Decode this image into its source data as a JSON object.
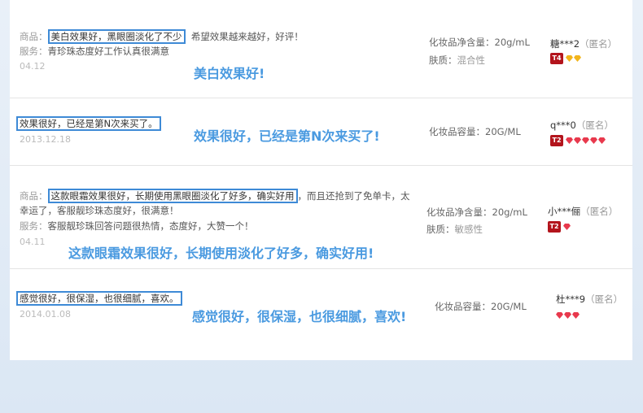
{
  "reviews": [
    {
      "product_label": "商品：",
      "product_text": "美白效果好，黑眼圈淡化了不少",
      "product_more": "希望效果越来越好，好评！",
      "service_label": "服务：",
      "service_text": "青珍珠态度好工作认真很满意",
      "date": "04.12",
      "annotation": "美白效果好!",
      "attr1": "化妆品净含量：20g/mL",
      "attr2_label": "肤质：",
      "attr2_value": "混合性",
      "user": "糖***2",
      "anon": "（匿名）",
      "level": "T4",
      "gem_color": "gold",
      "gem_count": 2
    },
    {
      "product_text": "效果很好，已经是第N次来买了。",
      "date": "2013.12.18",
      "annotation": "效果很好，已经是第N次来买了!",
      "attr1": "化妆品容量：20G/ML",
      "user": "q***0",
      "anon": "（匿名）",
      "level": "T2",
      "gem_color": "red",
      "gem_count": 5
    },
    {
      "product_label": "商品：",
      "product_text": "这款眼霜效果很好，长期使用黑眼圈淡化了好多，确实好用",
      "product_more": "，而且还抢到了免单卡，太",
      "product_more2": "幸运了，客服靓珍珠态度好，很满意！",
      "service_label": "服务：",
      "service_text": "客服靓珍珠回答问题很热情，态度好，大赞一个！",
      "date": "04.11",
      "annotation": "这款眼霜效果很好，长期使用淡化了好多，确实好用!",
      "attr1": "化妆品净含量：20g/mL",
      "attr2_label": "肤质：",
      "attr2_value": "敏感性",
      "user": "小***俪",
      "anon": "（匿名）",
      "level": "T2",
      "gem_color": "red",
      "gem_count": 1
    },
    {
      "product_text": "感觉很好，很保湿，也很细腻，喜欢。",
      "date": "2014.01.08",
      "annotation": "感觉很好，很保湿，也很细腻，喜欢!",
      "attr1": "化妆品容量：20G/ML",
      "user": "杜***9",
      "anon": "（匿名）",
      "gem_color": "red",
      "gem_count": 3
    }
  ]
}
